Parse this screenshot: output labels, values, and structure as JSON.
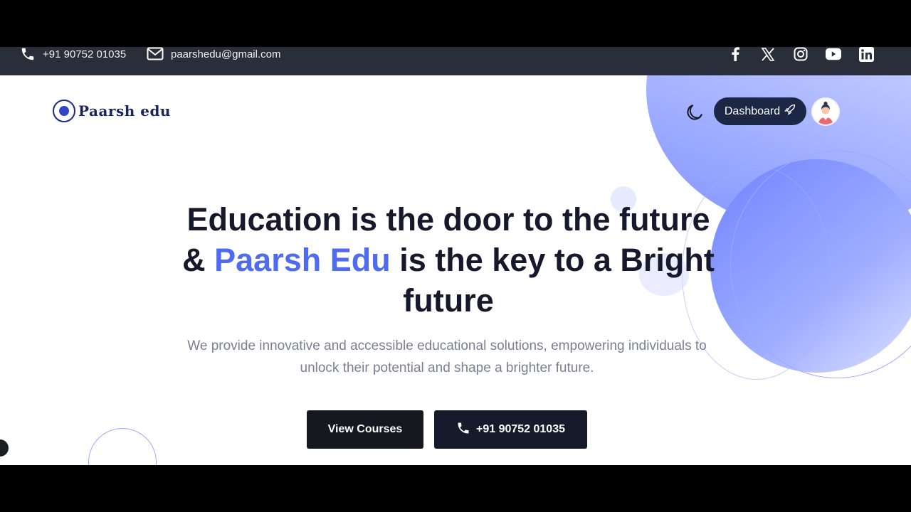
{
  "topbar": {
    "phone": "+91 90752 01035",
    "email": "paarshedu@gmail.com",
    "socials": [
      "facebook-icon",
      "x-icon",
      "instagram-icon",
      "youtube-icon",
      "linkedin-icon"
    ]
  },
  "nav": {
    "logo_text": "Paarsh edu",
    "dashboard_label": "Dashboard"
  },
  "hero": {
    "title_part1": "Education is the door to the future",
    "title_part2": "&",
    "title_accent": "Paarsh Edu",
    "title_part3": "is the key to a Bright future",
    "subtitle": "We provide innovative and accessible educational solutions, empowering individuals to unlock their potential and shape a brighter future.",
    "primary_button": "View Courses",
    "call_button": "+91 90752 01035"
  },
  "colors": {
    "accent": "#4f6bf0",
    "topbar_bg": "#2a2d3a",
    "button_dark": "#16171f",
    "dashboard_bg": "#1b2745"
  }
}
